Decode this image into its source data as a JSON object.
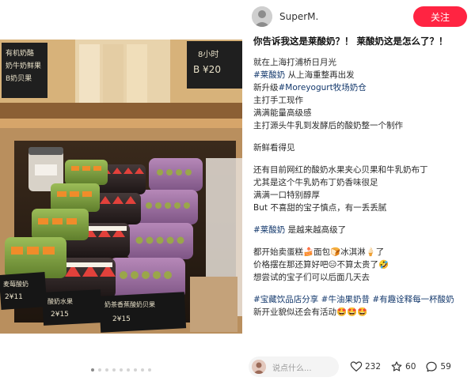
{
  "author": {
    "name": "SuperM.",
    "follow_label": "关注"
  },
  "post": {
    "title": "你告诉我这是莱酸奶？！ 莱酸奶这是怎么了？！",
    "body": [
      {
        "text": "就在上海打浦桥日月光"
      },
      {
        "tag": "#莱酸奶",
        "text": " 从上海重整再出发"
      },
      {
        "text": "新升级",
        "tag": "#Moreyogurt牧场奶仓"
      },
      {
        "text": "主打手工现作"
      },
      {
        "text": "满满能量高级感"
      },
      {
        "text": "主打源头牛乳到发酵后的酸奶整一个制作"
      },
      {
        "blank": true
      },
      {
        "text": "新鲜看得见"
      },
      {
        "blank": true
      },
      {
        "text": "还有目前网红的酸奶水果夹心贝果和牛乳奶布丁"
      },
      {
        "text": "尤其是这个牛乳奶布丁奶香味很足"
      },
      {
        "text": "满满一口特别醇厚"
      },
      {
        "text": "But 不喜甜的宝子慎点，有一丢丢腻"
      },
      {
        "blank": true
      },
      {
        "tag": "#莱酸奶",
        "text": " 是越来越高级了"
      },
      {
        "blank": true
      },
      {
        "text": "都开始卖蛋糕🍰面包🍞冰淇淋🍦了"
      },
      {
        "text": "价格摆在那还算好吧😑不算太贵了🤣"
      },
      {
        "text": "想尝试的宝子们可以后面几天去"
      },
      {
        "blank": true
      },
      {
        "tags": [
          "#宝藏饮品店分享",
          "#牛油果奶昔",
          "#有趣诠释每一杯酸奶"
        ]
      },
      {
        "text": "新开业貌似还会有活动🤩🤩🤩"
      }
    ]
  },
  "photo": {
    "signs": {
      "top_left": [
        "有机奶酪",
        "奶牛奶鲜果",
        "B奶贝果"
      ],
      "top_right": [
        "8小时",
        "B ¥20"
      ],
      "price_1": [
        "麦莓酸奶",
        "2¥11"
      ],
      "price_2": [
        "酸奶水果",
        "2¥15"
      ],
      "price_3": [
        "奶茶香蕉酸奶贝果",
        "2¥15"
      ]
    },
    "page_count": 9,
    "active_page": 1
  },
  "footer": {
    "comment_placeholder": "说点什么...",
    "likes": "232",
    "stars": "60",
    "comments": "59"
  },
  "colors": {
    "brand": "#ff2442",
    "tag": "#13386c"
  }
}
